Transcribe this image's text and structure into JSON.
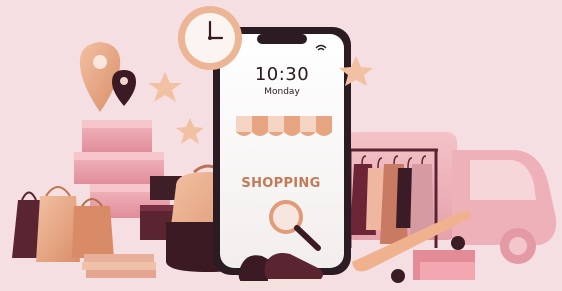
{
  "phone": {
    "time": "10:30",
    "day": "Monday",
    "label": "SHOPPING"
  },
  "colors": {
    "background": "#f6dfe2",
    "accent_pink": "#e99aa6",
    "accent_peach": "#e8a884",
    "burgundy": "#5b2431",
    "phone_body": "#2a1c22"
  },
  "icons": [
    "location-pin-icon",
    "clock-icon",
    "star-icon",
    "magnifier-icon",
    "wifi-icon"
  ]
}
